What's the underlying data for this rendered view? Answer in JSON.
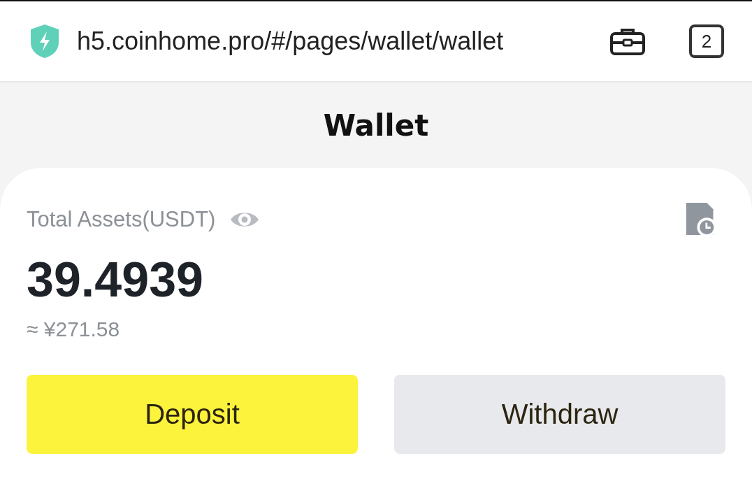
{
  "browser": {
    "url": "h5.coinhome.pro/#/pages/wallet/wallet",
    "tab_count": "2"
  },
  "header": {
    "title": "Wallet"
  },
  "assets": {
    "label": "Total Assets(USDT)",
    "amount": "39.4939",
    "fiat": "≈ ¥271.58"
  },
  "buttons": [
    {
      "label": "Deposit",
      "kind": "primary"
    },
    {
      "label": "Withdraw",
      "kind": "secondary"
    }
  ]
}
